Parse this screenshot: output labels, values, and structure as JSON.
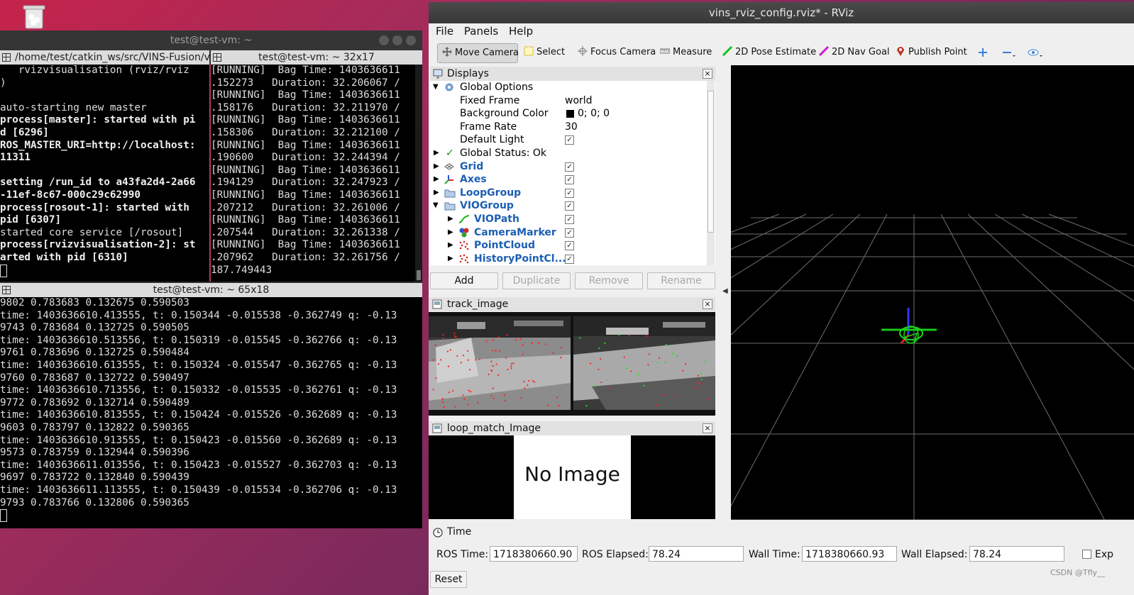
{
  "desktop": {
    "trash_icon": "trash-icon",
    "watermark": "CSDN @Tfly__"
  },
  "terminal": {
    "title": "test@test-vm: ~",
    "pane_left": {
      "title": "/home/test/catkin_ws/src/VINS-Fusion/v",
      "lines": [
        {
          "t": "   rvizvisualisation (rviz/rviz",
          "b": false
        },
        {
          "t": ")",
          "b": false
        },
        {
          "t": "",
          "b": false
        },
        {
          "t": "auto-starting new master",
          "b": false
        },
        {
          "t": "process[master]: started with pi",
          "b": true
        },
        {
          "t": "d [6296]",
          "b": true
        },
        {
          "t": "ROS_MASTER_URI=http://localhost:",
          "b": true
        },
        {
          "t": "11311",
          "b": true
        },
        {
          "t": "",
          "b": false
        },
        {
          "t": "setting /run_id to a43fa2d4-2a66",
          "b": true
        },
        {
          "t": "-11ef-8c67-000c29c62990",
          "b": true
        },
        {
          "t": "process[rosout-1]: started with",
          "b": true
        },
        {
          "t": "pid [6307]",
          "b": true
        },
        {
          "t": "started core service [/rosout]",
          "b": false
        },
        {
          "t": "process[rvizvisualisation-2]: st",
          "b": true
        },
        {
          "t": "arted with pid [6310]",
          "b": true
        }
      ]
    },
    "pane_right": {
      "title": "test@test-vm: ~ 32x17",
      "lines": [
        "[RUNNING]  Bag Time: 1403636611",
        ".152273   Duration: 32.206067 /",
        "[RUNNING]  Bag Time: 1403636611",
        ".158176   Duration: 32.211970 /",
        "[RUNNING]  Bag Time: 1403636611",
        ".158306   Duration: 32.212100 /",
        "[RUNNING]  Bag Time: 1403636611",
        ".190600   Duration: 32.244394 /",
        "[RUNNING]  Bag Time: 1403636611",
        ".194129   Duration: 32.247923 /",
        "[RUNNING]  Bag Time: 1403636611",
        ".207212   Duration: 32.261006 /",
        "[RUNNING]  Bag Time: 1403636611",
        ".207544   Duration: 32.261338 /",
        "[RUNNING]  Bag Time: 1403636611",
        ".207962   Duration: 32.261756 /",
        "187.749443"
      ]
    },
    "pane_bottom": {
      "title": "test@test-vm: ~ 65x18",
      "lines": [
        "9802 0.783683 0.132675 0.590503",
        "time: 1403636610.413555, t: 0.150344 -0.015538 -0.362749 q: -0.13",
        "9743 0.783684 0.132725 0.590505",
        "time: 1403636610.513556, t: 0.150319 -0.015545 -0.362766 q: -0.13",
        "9761 0.783696 0.132725 0.590484",
        "time: 1403636610.613555, t: 0.150324 -0.015547 -0.362765 q: -0.13",
        "9760 0.783687 0.132722 0.590497",
        "time: 1403636610.713556, t: 0.150332 -0.015535 -0.362761 q: -0.13",
        "9772 0.783692 0.132714 0.590489",
        "time: 1403636610.813555, t: 0.150424 -0.015526 -0.362689 q: -0.13",
        "9603 0.783797 0.132822 0.590365",
        "time: 1403636610.913555, t: 0.150423 -0.015560 -0.362689 q: -0.13",
        "9573 0.783759 0.132944 0.590396",
        "time: 1403636611.013556, t: 0.150423 -0.015527 -0.362703 q: -0.13",
        "9697 0.783722 0.132840 0.590439",
        "time: 1403636611.113555, t: 0.150439 -0.015534 -0.362706 q: -0.13",
        "9793 0.783766 0.132806 0.590365"
      ]
    }
  },
  "rviz": {
    "title": "vins_rviz_config.rviz* - RViz",
    "menu": [
      "File",
      "Panels",
      "Help"
    ],
    "toolbar": [
      {
        "label": "Move Camera",
        "icon": "move-camera-icon",
        "color": "#6a6a6a"
      },
      {
        "label": "Select",
        "icon": "select-icon",
        "color": "#c8a400"
      },
      {
        "label": "Focus Camera",
        "icon": "focus-camera-icon",
        "color": "#777777"
      },
      {
        "label": "Measure",
        "icon": "measure-icon",
        "color": "#777777"
      },
      {
        "label": "2D Pose Estimate",
        "icon": "pose-estimate-icon",
        "color": "#19c319"
      },
      {
        "label": "2D Nav Goal",
        "icon": "nav-goal-icon",
        "color": "#d21cd2"
      },
      {
        "label": "Publish Point",
        "icon": "publish-point-icon",
        "color": "#c0392b"
      }
    ],
    "displays": {
      "title": "Displays",
      "global_options": "Global Options",
      "rows": [
        {
          "label": "Fixed Frame",
          "value": "world"
        },
        {
          "label": "Background Color",
          "value": "0; 0; 0"
        },
        {
          "label": "Frame Rate",
          "value": "30"
        },
        {
          "label": "Default Light",
          "value": "✓"
        }
      ],
      "global_status": "Global Status: Ok",
      "items": [
        {
          "label": "Grid",
          "check": "✓"
        },
        {
          "label": "Axes",
          "check": "✓"
        },
        {
          "label": "LoopGroup",
          "check": "✓"
        },
        {
          "label": "VIOGroup",
          "check": "✓"
        },
        {
          "label": "VIOPath",
          "check": "✓"
        },
        {
          "label": "CameraMarker",
          "check": "✓"
        },
        {
          "label": "PointCloud",
          "check": "✓"
        },
        {
          "label": "HistoryPointCl...",
          "check": "✓"
        }
      ],
      "buttons": {
        "add": "Add",
        "duplicate": "Duplicate",
        "remove": "Remove",
        "rename": "Rename"
      }
    },
    "track_image": {
      "title": "track_image"
    },
    "loop_match": {
      "title": "loop_match_Image",
      "no_image": "No Image"
    },
    "time": {
      "title": "Time",
      "ros_time_label": "ROS Time:",
      "ros_time": "1718380660.90",
      "ros_elapsed_label": "ROS Elapsed:",
      "ros_elapsed": "78.24",
      "wall_time_label": "Wall Time:",
      "wall_time": "1718380660.93",
      "wall_elapsed_label": "Wall Elapsed:",
      "wall_elapsed": "78.24",
      "experimental_label": "Exp",
      "reset": "Reset"
    }
  }
}
